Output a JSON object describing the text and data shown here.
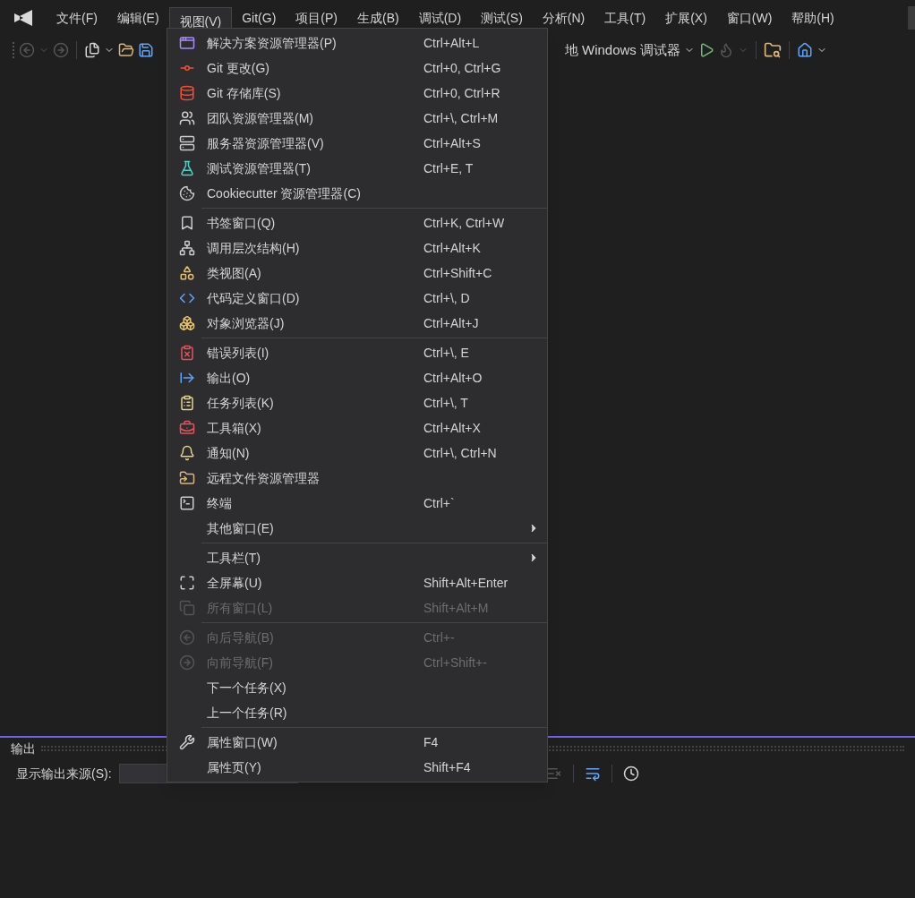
{
  "menubar": [
    {
      "label": "文件(F)",
      "selected": false
    },
    {
      "label": "编辑(E)",
      "selected": false
    },
    {
      "label": "视图(V)",
      "selected": true
    },
    {
      "label": "Git(G)",
      "selected": false
    },
    {
      "label": "项目(P)",
      "selected": false
    },
    {
      "label": "生成(B)",
      "selected": false
    },
    {
      "label": "调试(D)",
      "selected": false
    },
    {
      "label": "测试(S)",
      "selected": false
    },
    {
      "label": "分析(N)",
      "selected": false
    },
    {
      "label": "工具(T)",
      "selected": false
    },
    {
      "label": "扩展(X)",
      "selected": false
    },
    {
      "label": "窗口(W)",
      "selected": false
    },
    {
      "label": "帮助(H)",
      "selected": false
    }
  ],
  "toolbar": {
    "debugger": "地 Windows 调试器"
  },
  "view_menu": {
    "items": [
      {
        "kind": "item",
        "label": "解决方案资源管理器(P)",
        "shortcut": "Ctrl+Alt+L",
        "disabled": false
      },
      {
        "kind": "item",
        "label": "Git 更改(G)",
        "shortcut": "Ctrl+0, Ctrl+G",
        "disabled": false
      },
      {
        "kind": "item",
        "label": "Git 存储库(S)",
        "shortcut": "Ctrl+0, Ctrl+R",
        "disabled": false
      },
      {
        "kind": "item",
        "label": "团队资源管理器(M)",
        "shortcut": "Ctrl+\\, Ctrl+M",
        "disabled": false
      },
      {
        "kind": "item",
        "label": "服务器资源管理器(V)",
        "shortcut": "Ctrl+Alt+S",
        "disabled": false
      },
      {
        "kind": "item",
        "label": "测试资源管理器(T)",
        "shortcut": "Ctrl+E, T",
        "disabled": false
      },
      {
        "kind": "item",
        "label": "Cookiecutter 资源管理器(C)",
        "disabled": false
      },
      {
        "kind": "separator"
      },
      {
        "kind": "item",
        "label": "书签窗口(Q)",
        "shortcut": "Ctrl+K, Ctrl+W",
        "disabled": false
      },
      {
        "kind": "item",
        "label": "调用层次结构(H)",
        "shortcut": "Ctrl+Alt+K",
        "disabled": false
      },
      {
        "kind": "item",
        "label": "类视图(A)",
        "shortcut": "Ctrl+Shift+C",
        "disabled": false
      },
      {
        "kind": "item",
        "label": "代码定义窗口(D)",
        "shortcut": "Ctrl+\\, D",
        "disabled": false
      },
      {
        "kind": "item",
        "label": "对象浏览器(J)",
        "shortcut": "Ctrl+Alt+J",
        "disabled": false
      },
      {
        "kind": "separator"
      },
      {
        "kind": "item",
        "label": "错误列表(I)",
        "shortcut": "Ctrl+\\, E",
        "disabled": false
      },
      {
        "kind": "item",
        "label": "输出(O)",
        "shortcut": "Ctrl+Alt+O",
        "disabled": false
      },
      {
        "kind": "item",
        "label": "任务列表(K)",
        "shortcut": "Ctrl+\\, T",
        "disabled": false
      },
      {
        "kind": "item",
        "label": "工具箱(X)",
        "shortcut": "Ctrl+Alt+X",
        "disabled": false
      },
      {
        "kind": "item",
        "label": "通知(N)",
        "shortcut": "Ctrl+\\, Ctrl+N",
        "disabled": false
      },
      {
        "kind": "item",
        "label": "远程文件资源管理器",
        "disabled": false
      },
      {
        "kind": "item",
        "label": "终端",
        "shortcut": "Ctrl+`",
        "disabled": false
      },
      {
        "kind": "submenu",
        "label": "其他窗口(E)",
        "disabled": false
      },
      {
        "kind": "separator"
      },
      {
        "kind": "submenu",
        "label": "工具栏(T)",
        "disabled": false
      },
      {
        "kind": "item",
        "label": "全屏幕(U)",
        "shortcut": "Shift+Alt+Enter",
        "disabled": false
      },
      {
        "kind": "item",
        "label": "所有窗口(L)",
        "shortcut": "Shift+Alt+M",
        "disabled": true
      },
      {
        "kind": "separator"
      },
      {
        "kind": "item",
        "label": "向后导航(B)",
        "shortcut": "Ctrl+-",
        "disabled": true
      },
      {
        "kind": "item",
        "label": "向前导航(F)",
        "shortcut": "Ctrl+Shift+-",
        "disabled": true
      },
      {
        "kind": "item",
        "label": "下一个任务(X)",
        "disabled": false
      },
      {
        "kind": "item",
        "label": "上一个任务(R)",
        "disabled": false
      },
      {
        "kind": "separator"
      },
      {
        "kind": "item",
        "label": "属性窗口(W)",
        "shortcut": "F4",
        "disabled": false
      },
      {
        "kind": "item",
        "label": "属性页(Y)",
        "shortcut": "Shift+F4",
        "disabled": false
      }
    ]
  },
  "output_panel": {
    "title": "输出",
    "source_label": "显示输出来源(S):"
  }
}
